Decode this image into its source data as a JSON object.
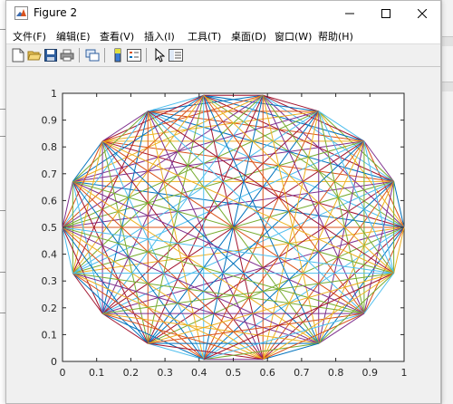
{
  "window": {
    "title": "Figure 2"
  },
  "menu": [
    {
      "label": "文件(F)"
    },
    {
      "label": "编辑(E)"
    },
    {
      "label": "查看(V)"
    },
    {
      "label": "插入(I)"
    },
    {
      "label": "工具(T)"
    },
    {
      "label": "桌面(D)"
    },
    {
      "label": "窗口(W)"
    },
    {
      "label": "帮助(H)"
    }
  ],
  "toolbar": [
    "new-figure-icon",
    "open-file-icon",
    "save-icon",
    "print-icon",
    "link-plot-icon",
    "insert-colorbar-icon",
    "insert-legend-icon",
    "edit-plot-arrow-icon",
    "property-inspector-icon"
  ],
  "chart_data": {
    "type": "line",
    "description": "Regular 18-gon inscribed in a circle centered at (0.5,0.5) with radius 0.5; every vertex connected to every other vertex (complete graph) with MATLAB default color order",
    "center": [
      0.5,
      0.5
    ],
    "radius": 0.5,
    "num_points": 18,
    "xlim": [
      0,
      1
    ],
    "ylim": [
      0,
      1
    ],
    "xticks": [
      "0",
      "0.1",
      "0.2",
      "0.3",
      "0.4",
      "0.5",
      "0.6",
      "0.7",
      "0.8",
      "0.9",
      "1"
    ],
    "yticks": [
      "0",
      "0.1",
      "0.2",
      "0.3",
      "0.4",
      "0.5",
      "0.6",
      "0.7",
      "0.8",
      "0.9",
      "1"
    ],
    "colors": [
      "#0072BD",
      "#D95319",
      "#EDB120",
      "#7E2F8E",
      "#77AC30",
      "#4DBEEE",
      "#A2142F"
    ],
    "grid": false,
    "legend": "none"
  }
}
